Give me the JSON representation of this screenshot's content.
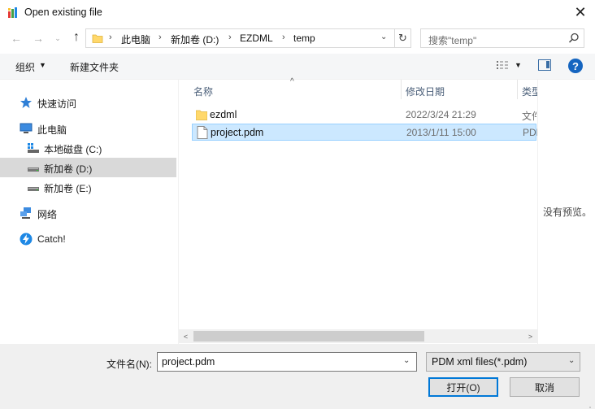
{
  "window": {
    "title": "Open existing file",
    "close_glyph": "✕"
  },
  "address": {
    "back_glyph": "←",
    "forward_glyph": "→",
    "recent_glyph": "⌄",
    "up_glyph": "↑",
    "crumbs": [
      "此电脑",
      "新加卷 (D:)",
      "EZDML",
      "temp"
    ],
    "separator": "›",
    "dropdown_glyph": "⌄",
    "refresh_glyph": "↻"
  },
  "search": {
    "placeholder": "搜索\"temp\""
  },
  "toolbar": {
    "organize_label": "组织",
    "organize_caret": "▼",
    "new_folder_label": "新建文件夹",
    "view_caret": "▼",
    "help_glyph": "?"
  },
  "nav": {
    "quick_access": "快速访问",
    "this_pc": "此电脑",
    "drive_c": "本地磁盘 (C:)",
    "drive_d": "新加卷 (D:)",
    "drive_e": "新加卷 (E:)",
    "network": "网络",
    "catch": "Catch!"
  },
  "columns": {
    "name": "名称",
    "date": "修改日期",
    "type": "类型",
    "sort_glyph": "^"
  },
  "files": [
    {
      "name": "ezdml",
      "date": "2022/3/24 21:29",
      "type": "文件夹",
      "icon": "folder-icon"
    },
    {
      "name": "project.pdm",
      "date": "2013/1/11 15:00",
      "type": "PDM",
      "icon": "file-icon",
      "selected": true
    }
  ],
  "scrollbar": {
    "left_glyph": "<",
    "right_glyph": ">"
  },
  "preview": {
    "text": "没有预览。"
  },
  "bottom": {
    "filename_label": "文件名(N):",
    "filename_value": "project.pdm",
    "filename_dd": "⌄",
    "filetype_value": "PDM xml files(*.pdm)",
    "filetype_dd": "⌄",
    "open_label": "打开(O)",
    "cancel_label": "取消"
  },
  "colors": {
    "selection": "#cce8ff",
    "selection_border": "#99d1ff",
    "nav_selected": "#d9d9d9",
    "accent": "#0078d7",
    "folder": "#ffd86b"
  }
}
